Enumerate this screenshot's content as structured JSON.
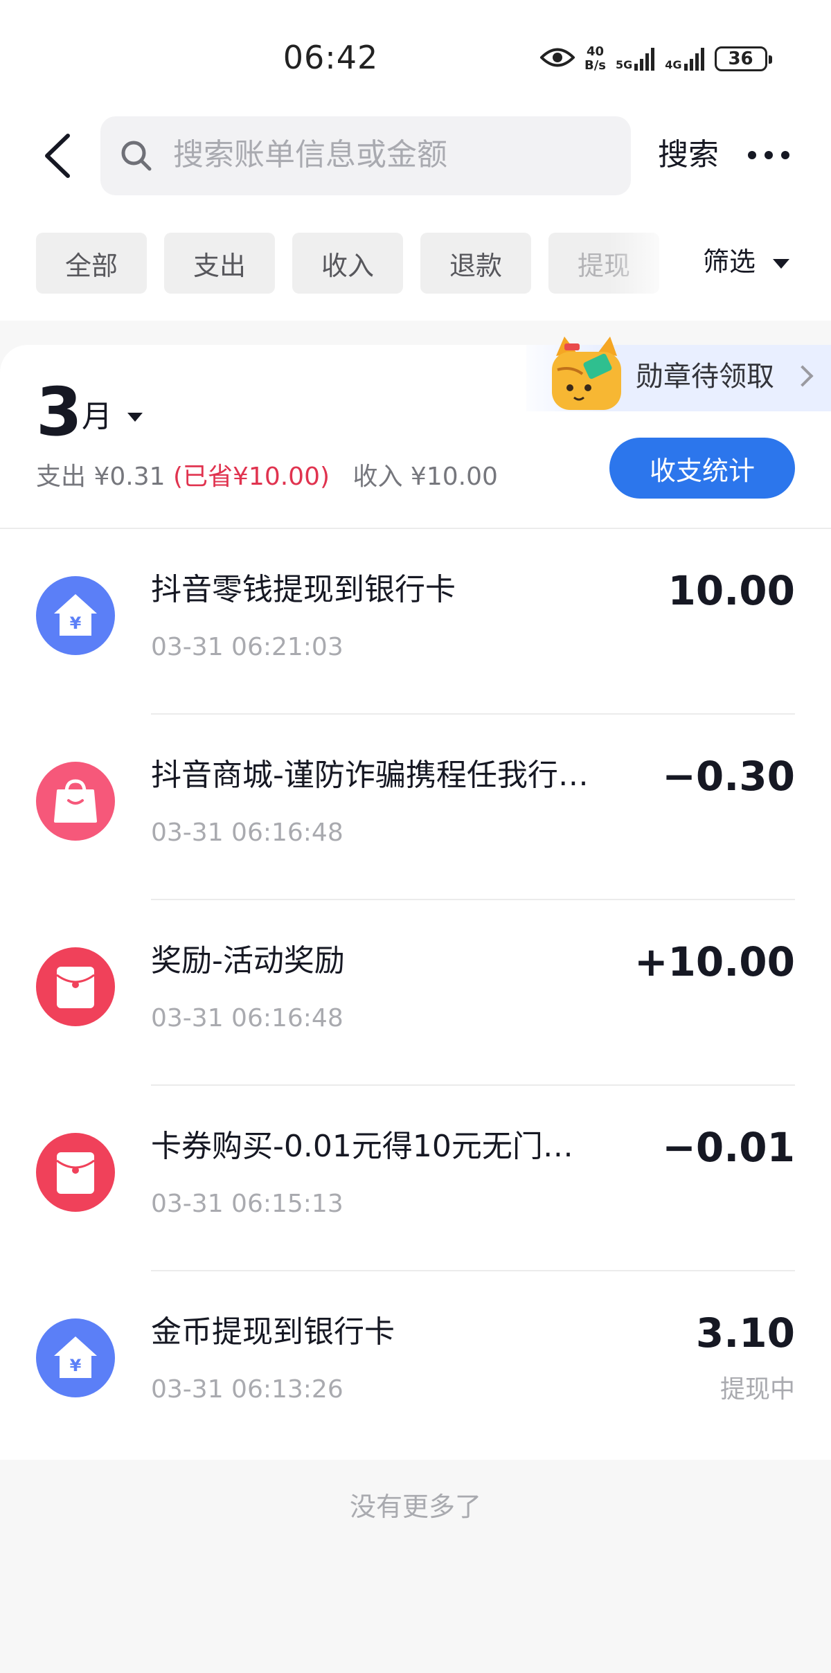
{
  "status_bar": {
    "time": "06:42",
    "net_speed_value": "40",
    "net_speed_unit": "B/s",
    "signal_1": "5G",
    "signal_2": "4G",
    "battery": "36"
  },
  "header": {
    "search_placeholder": "搜索账单信息或金额",
    "search_button": "搜索"
  },
  "filters": {
    "chips": [
      "全部",
      "支出",
      "收入",
      "退款",
      "提现"
    ],
    "filter_button": "筛选"
  },
  "month": {
    "number": "3",
    "unit": "月",
    "expense_label": "支出 ¥0.31",
    "saved_label": "(已省¥10.00)",
    "income_label": "收入 ¥10.00",
    "stats_button": "收支统计",
    "badge": "勋章待领取"
  },
  "transactions": [
    {
      "title": "抖音零钱提现到银行卡",
      "time": "03-31 06:21:03",
      "amount": "10.00",
      "status": "",
      "icon": "withdraw-house-icon"
    },
    {
      "title": "抖音商城-谨防诈骗携程任我行…",
      "time": "03-31 06:16:48",
      "amount": "−0.30",
      "status": "",
      "icon": "shopping-bag-icon"
    },
    {
      "title": "奖励-活动奖励",
      "time": "03-31 06:16:48",
      "amount": "+10.00",
      "status": "",
      "icon": "red-envelope-icon"
    },
    {
      "title": "卡券购买-0.01元得10元无门…",
      "time": "03-31 06:15:13",
      "amount": "−0.01",
      "status": "",
      "icon": "red-envelope-icon"
    },
    {
      "title": "金币提现到银行卡",
      "time": "03-31 06:13:26",
      "amount": "3.10",
      "status": "提现中",
      "icon": "withdraw-house-icon"
    }
  ],
  "footer": "没有更多了",
  "colors": {
    "accent_blue": "#2c76ec",
    "saved_red": "#e0334f",
    "icon_blue": "#5b7ff7",
    "icon_pink": "#f6587a",
    "icon_red": "#f0415a"
  }
}
